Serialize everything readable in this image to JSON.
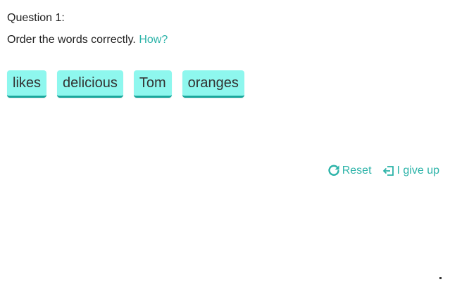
{
  "question": {
    "label": "Question 1:",
    "instruction": "Order the words correctly.",
    "help_link": "How?"
  },
  "words": [
    {
      "text": "likes"
    },
    {
      "text": "delicious"
    },
    {
      "text": "Tom"
    },
    {
      "text": "oranges"
    }
  ],
  "controls": {
    "reset_label": "Reset",
    "give_up_label": "I give up"
  },
  "colors": {
    "accent": "#2bb3a8",
    "tile_bg": "#8ef7ee",
    "tile_border": "#1aa79c"
  },
  "icons": {
    "reset": "rotate-cw-icon",
    "give_up": "sign-out-icon"
  }
}
